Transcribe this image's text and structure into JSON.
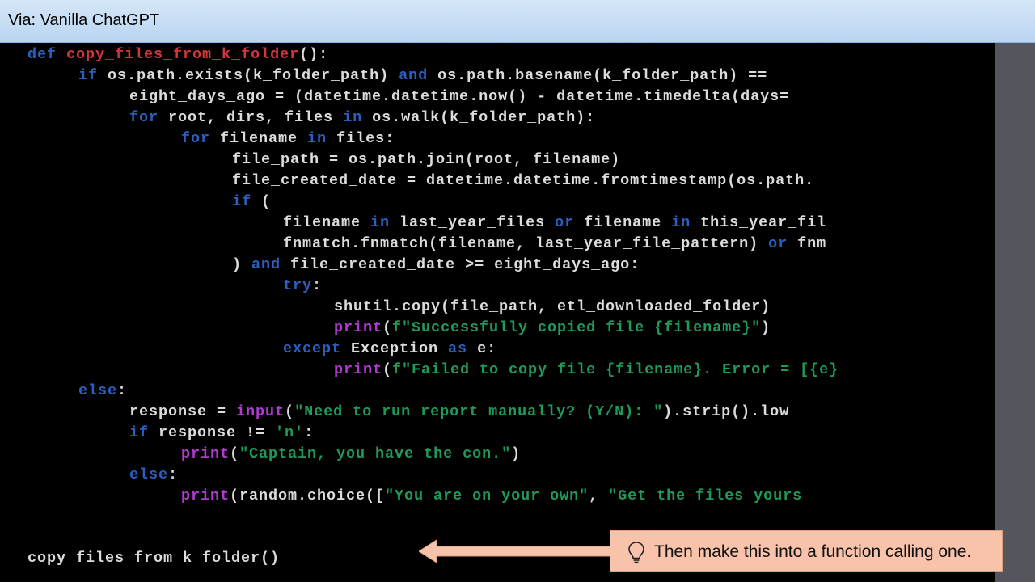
{
  "window": {
    "title": "Via: Vanilla ChatGPT"
  },
  "colors": {
    "keyword": "#2c5fbf",
    "function_name": "#d1363a",
    "text": "#dcdcdc",
    "string": "#1f9a5a",
    "builtin": "#b23ad1",
    "callout_bg": "#f8c3aa"
  },
  "code": {
    "line1": {
      "kw": "def",
      "name": "copy_files_from_k_folder",
      "rest": "():"
    },
    "line2": {
      "kw1": "if",
      "t1": " os.path.exists(k_folder_path) ",
      "kw2": "and",
      "t2": " os.path.basename(k_folder_path) =="
    },
    "line3": {
      "t1": "eight_days_ago = (datetime.datetime.now() - datetime.timedelta(days="
    },
    "line4": {
      "kw1": "for",
      "t1": " root, dirs, files ",
      "kw2": "in",
      "t2": " os.walk(k_folder_path):"
    },
    "line5": {
      "kw1": "for",
      "t1": " filename ",
      "kw2": "in",
      "t2": " files:"
    },
    "line6": {
      "t1": "file_path = os.path.join(root, filename)"
    },
    "line7": {
      "t1": "file_created_date = datetime.datetime.fromtimestamp(os.path."
    },
    "line8": {
      "kw1": "if",
      "t1": " ("
    },
    "line9": {
      "t1": "filename ",
      "kw1": "in",
      "t2": " last_year_files ",
      "kw2": "or",
      "t3": " filename ",
      "kw3": "in",
      "t4": " this_year_fil"
    },
    "line10": {
      "t1": "fnmatch.fnmatch(filename, last_year_file_pattern) ",
      "kw1": "or",
      "t2": " fnm"
    },
    "line11": {
      "t1": ") ",
      "kw1": "and",
      "t2": " file_created_date >= eight_days_ago:"
    },
    "line12": {
      "kw1": "try",
      "t1": ":"
    },
    "line13": {
      "t1": "shutil.copy(file_path, etl_downloaded_folder)"
    },
    "line14": {
      "bi": "print",
      "t1": "(",
      "st": "f\"Successfully copied file {filename}\"",
      "t2": ")"
    },
    "line15": {
      "kw1": "except",
      "t1": " Exception ",
      "kw2": "as",
      "t2": " e:"
    },
    "line16": {
      "bi": "print",
      "t1": "(",
      "st": "f\"Failed to copy file {filename}. Error = [{e}"
    },
    "line17": {
      "kw1": "else",
      "t1": ":"
    },
    "line18": {
      "t1": "response = ",
      "bi": "input",
      "t2": "(",
      "st": "\"Need to run report manually? (Y/N): \"",
      "t3": ").strip().low"
    },
    "line19": {
      "kw1": "if",
      "t1": " response != ",
      "st": "'n'",
      "t2": ":"
    },
    "line20": {
      "bi": "print",
      "t1": "(",
      "st": "\"Captain, you have the con.\"",
      "t2": ")"
    },
    "line21": {
      "kw1": "else",
      "t1": ":"
    },
    "line22": {
      "bi": "print",
      "t1": "(random.choice([",
      "st1": "\"You are on your own\"",
      "t2": ", ",
      "st2": "\"Get the files yours"
    },
    "line23": {
      "t1": "copy_files_from_k_folder()"
    }
  },
  "callout": {
    "text": "Then make this into a function calling one.",
    "icon": "lightbulb-icon"
  }
}
